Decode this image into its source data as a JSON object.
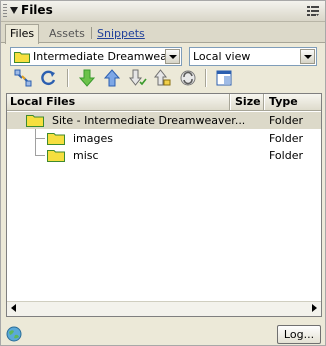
{
  "panel": {
    "title": "Files"
  },
  "tabs": [
    {
      "label": "Files",
      "active": true
    },
    {
      "label": "Assets",
      "active": false
    },
    {
      "label": "Snippets",
      "active": false
    }
  ],
  "site_select": {
    "value": "Intermediate Dreamweaver"
  },
  "view_select": {
    "value": "Local view"
  },
  "toolbar": {
    "buttons": [
      "connect-icon",
      "refresh-icon",
      "get-icon",
      "put-icon",
      "check-out-icon",
      "check-in-icon",
      "synchronize-icon",
      "expand-icon"
    ]
  },
  "file_list": {
    "columns": {
      "name": "Local Files",
      "size": "Size",
      "type": "Type"
    },
    "rows": [
      {
        "name": "Site - Intermediate Dreamweaver...",
        "size": "",
        "type": "Folder",
        "selected": true
      },
      {
        "name": "images",
        "size": "",
        "type": "Folder",
        "selected": false
      },
      {
        "name": "misc",
        "size": "",
        "type": "Folder",
        "selected": false
      }
    ]
  },
  "footer": {
    "log_label": "Log..."
  },
  "colors": {
    "folder": "#f6df3f",
    "folder_outline": "#3e8a2f",
    "arrow_green": "#3a9a2c",
    "arrow_blue": "#2b5fb0"
  }
}
